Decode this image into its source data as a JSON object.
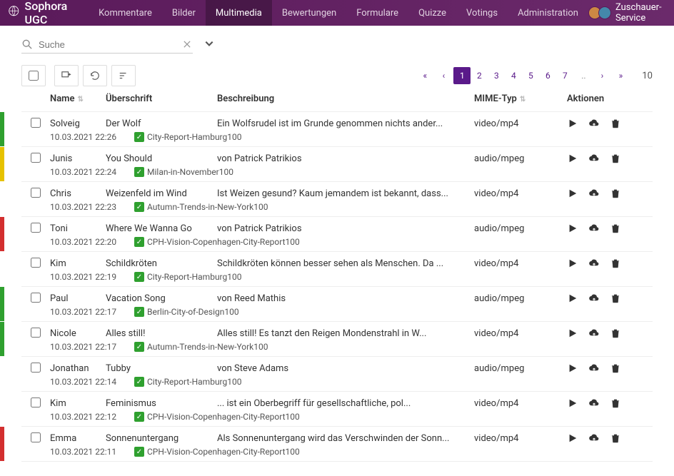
{
  "brand": "Sophora UGC",
  "nav": [
    {
      "label": "Kommentare",
      "active": false
    },
    {
      "label": "Bilder",
      "active": false
    },
    {
      "label": "Multimedia",
      "active": true
    },
    {
      "label": "Bewertungen",
      "active": false
    },
    {
      "label": "Formulare",
      "active": false
    },
    {
      "label": "Quizze",
      "active": false
    },
    {
      "label": "Votings",
      "active": false
    },
    {
      "label": "Administration",
      "active": false
    }
  ],
  "user_label": "Zuschauer-Service",
  "search": {
    "placeholder": "Suche"
  },
  "pagination": {
    "pages": [
      "1",
      "2",
      "3",
      "4",
      "5",
      "6",
      "7"
    ],
    "active": "1",
    "total": "10"
  },
  "columns": {
    "name": "Name",
    "heading": "Überschrift",
    "description": "Beschreibung",
    "mime": "MIME-Typ",
    "actions": "Aktionen"
  },
  "rows": [
    {
      "status": "green",
      "name": "Solveig",
      "heading": "Der Wolf",
      "description": "Ein Wolfsrudel ist im Grunde genommen nichts ander...",
      "mime": "video/mp4",
      "timestamp": "10.03.2021 22:26",
      "tag": "City-Report-Hamburg100"
    },
    {
      "status": "yellow",
      "name": "Junis",
      "heading": "You Should",
      "description": "von Patrick Patrikios",
      "mime": "audio/mpeg",
      "timestamp": "10.03.2021 22:24",
      "tag": "Milan-in-November100"
    },
    {
      "status": "none",
      "name": "Chris",
      "heading": "Weizenfeld im Wind",
      "description": "Ist Weizen gesund? Kaum jemandem ist bekannt, dass...",
      "mime": "video/mp4",
      "timestamp": "10.03.2021 22:23",
      "tag": "Autumn-Trends-in-New-York100"
    },
    {
      "status": "red",
      "name": "Toni",
      "heading": "Where We Wanna Go",
      "description": "von Patrick Patrikios",
      "mime": "audio/mpeg",
      "timestamp": "10.03.2021 22:20",
      "tag": "CPH-Vision-Copenhagen-City-Report100"
    },
    {
      "status": "none",
      "name": "Kim",
      "heading": "Schildkröten",
      "description": "Schildkröten können besser sehen als Menschen. Da ...",
      "mime": "video/mp4",
      "timestamp": "10.03.2021 22:19",
      "tag": "City-Report-Hamburg100"
    },
    {
      "status": "green",
      "name": "Paul",
      "heading": "Vacation Song",
      "description": "von Reed Mathis",
      "mime": "audio/mpeg",
      "timestamp": "10.03.2021 22:17",
      "tag": "Berlin-City-of-Design100"
    },
    {
      "status": "green",
      "name": "Nicole",
      "heading": "Alles still!",
      "description": "Alles still! Es tanzt den Reigen Mondenstrahl in W...",
      "mime": "video/mp4",
      "timestamp": "10.03.2021 22:17",
      "tag": "Autumn-Trends-in-New-York100"
    },
    {
      "status": "none",
      "name": "Jonathan",
      "heading": "Tubby",
      "description": "von Steve Adams",
      "mime": "audio/mpeg",
      "timestamp": "10.03.2021 22:14",
      "tag": "City-Report-Hamburg100"
    },
    {
      "status": "none",
      "name": "Kim",
      "heading": "Feminismus",
      "description": "... ist ein Oberbegriff für gesellschaftliche, pol...",
      "mime": "video/mp4",
      "timestamp": "10.03.2021 22:12",
      "tag": "CPH-Vision-Copenhagen-City-Report100"
    },
    {
      "status": "red",
      "name": "Emma",
      "heading": "Sonnenuntergang",
      "description": "Als Sonnenuntergang wird das Verschwinden der Sonn...",
      "mime": "video/mp4",
      "timestamp": "10.03.2021 22:11",
      "tag": "CPH-Vision-Copenhagen-City-Report100"
    }
  ]
}
